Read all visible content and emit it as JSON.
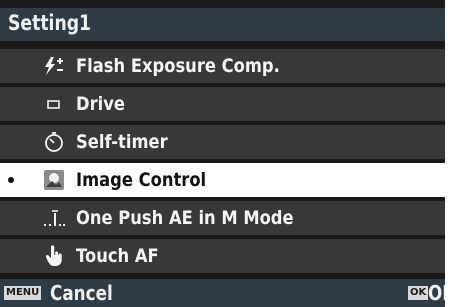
{
  "header": {
    "title": "Setting1"
  },
  "menu": {
    "items": [
      {
        "label": "Flash Exposure Comp.",
        "icon": "flash-exposure-comp-icon",
        "selected": false
      },
      {
        "label": "Drive",
        "icon": "drive-icon",
        "selected": false
      },
      {
        "label": "Self-timer",
        "icon": "self-timer-icon",
        "selected": false
      },
      {
        "label": "Image Control",
        "icon": "image-control-icon",
        "selected": true
      },
      {
        "label": "One Push AE in M Mode",
        "icon": "one-push-ae-icon",
        "selected": false
      },
      {
        "label": "Touch AF",
        "icon": "touch-af-icon",
        "selected": false
      }
    ]
  },
  "footer": {
    "menu_badge": "MENU",
    "cancel_label": "Cancel",
    "ok_badge": "OK",
    "ok_label": "OK"
  },
  "colors": {
    "title_bar": "#2e3c48",
    "menu_row": "#383838",
    "selected_row": "#ffffff",
    "screen_bg": "#1a1a1a"
  }
}
